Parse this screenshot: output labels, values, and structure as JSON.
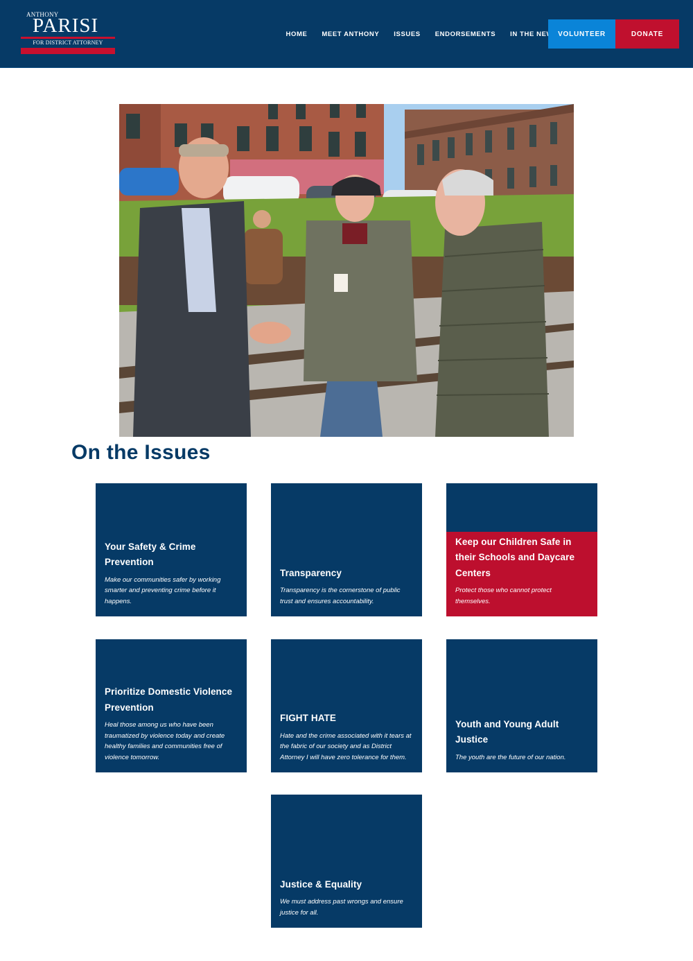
{
  "logo": {
    "small": "ANTHONY",
    "name": "PARISI",
    "sub": "FOR DISTRICT ATTORNEY"
  },
  "nav": {
    "items": [
      "HOME",
      "MEET ANTHONY",
      "ISSUES",
      "ENDORSEMENTS",
      "IN THE NEWS"
    ],
    "volunteer": "VOLUNTEER",
    "donate": "DONATE"
  },
  "colors": {
    "navy": "#063a66",
    "red": "#bd0f2e",
    "blue": "#0a84d8"
  },
  "section_title": "On the Issues",
  "issues": [
    {
      "title": "Your Safety & Crime Prevention",
      "desc": "Make our communities safer by working smarter and preventing crime before it happens."
    },
    {
      "title": "Transparency",
      "desc": "Transparency is the cornerstone of public trust and ensures accountability."
    },
    {
      "title": "Keep our Children Safe in their Schools and Daycare Centers",
      "desc": "Protect those who cannot protect themselves."
    },
    {
      "title": "Prioritize Domestic Violence Prevention",
      "desc": "Heal those among us who have been traumatized by violence today and create healthy families and communities free of violence tomorrow."
    },
    {
      "title": "FIGHT HATE",
      "desc": "Hate and the crime associated with it tears at the fabric of our society and as District Attorney I will have zero tolerance for them."
    },
    {
      "title": "Youth and Young Adult Justice",
      "desc": "The youth are the future of our nation."
    },
    {
      "title": "Justice & Equality",
      "desc": "We must address past wrongs and ensure justice for all."
    }
  ]
}
